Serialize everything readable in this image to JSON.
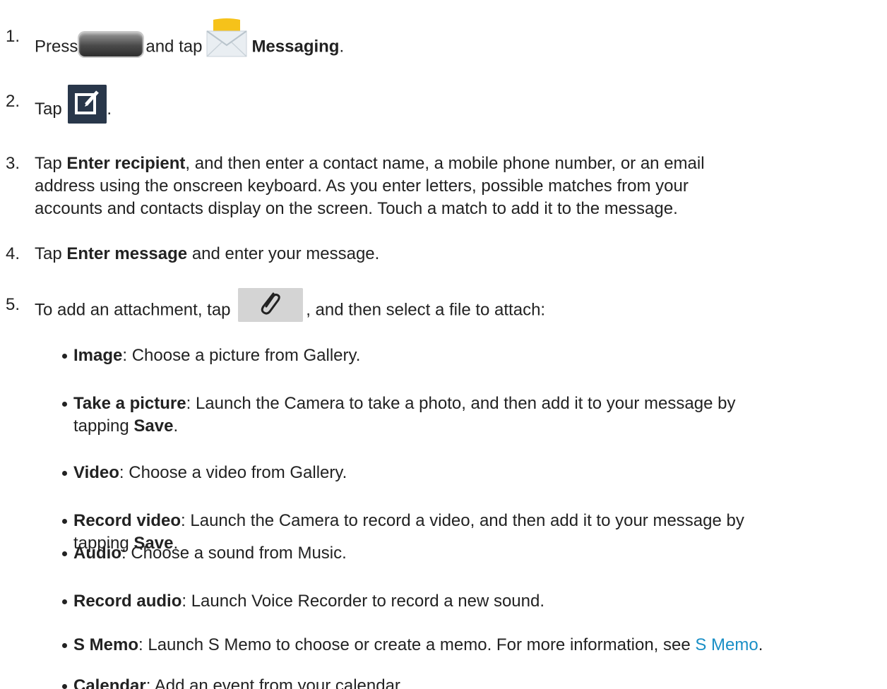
{
  "steps": [
    {
      "number": "1.",
      "press": "Press",
      "and_tap": "and tap",
      "messaging": "Messaging",
      "end": "."
    },
    {
      "number": "2.",
      "tap": "Tap",
      "end": "."
    },
    {
      "number": "3.",
      "tap": "Tap",
      "bold": "Enter recipient",
      "line1": ", and then enter a contact name, a mobile phone number, or an email",
      "line2": "address using the onscreen keyboard. As you enter letters, possible matches from your",
      "line3": "accounts and contacts display on the screen. Touch a match to add it to the message."
    },
    {
      "number": "4.",
      "tap": "Tap",
      "bold": "Enter message",
      "rest": "and enter your message."
    },
    {
      "number": "5.",
      "before": "To add an attachment, tap",
      "after": ", and then select a file to attach:"
    }
  ],
  "options": [
    {
      "bold": "Image",
      "text": ": Choose a picture from Gallery."
    },
    {
      "bold": "Take a picture",
      "text": ": Launch the Camera to take a photo, and then add it to your message by",
      "line2": "tapping",
      "bold2": "Save",
      "end": "."
    },
    {
      "bold": "Video",
      "text": ": Choose a video from Gallery."
    },
    {
      "bold": "Record video",
      "text": ": Launch the Camera to record a video, and then add it to your message by",
      "line2": "tapping",
      "bold2": "Save",
      "end": "."
    },
    {
      "bold": "Audio",
      "text": ": Choose a sound from Music."
    },
    {
      "bold": "Record audio",
      "text": ": Launch Voice Recorder to record a new sound."
    },
    {
      "bold": "S Memo",
      "text": ": Launch S Memo to choose or create a memo. For more information, see",
      "link": "S Memo",
      "end": "."
    },
    {
      "bold": "Calendar",
      "text": ": Add an event from your calendar."
    }
  ],
  "icons": {
    "home": "home-button-icon",
    "messaging": "messaging-envelope-icon",
    "compose": "compose-icon",
    "attach": "paperclip-icon",
    "link_color": "#1a8fc6"
  }
}
